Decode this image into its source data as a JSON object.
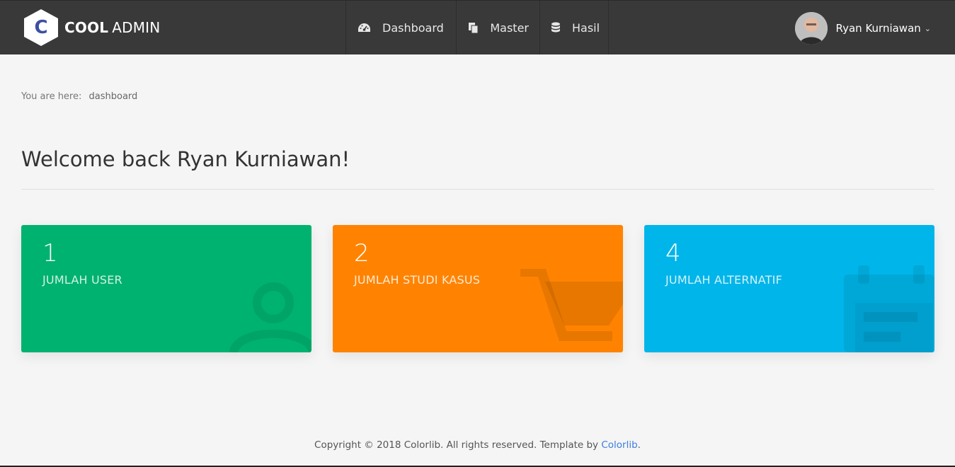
{
  "header": {
    "logo_letter": "C",
    "logo_bold": "COOL",
    "logo_light": "ADMIN",
    "nav": [
      {
        "label": "Dashboard",
        "icon": "dashboard-gauge-icon"
      },
      {
        "label": "Master",
        "icon": "copy-files-icon"
      },
      {
        "label": "Hasil",
        "icon": "database-icon"
      }
    ],
    "user_name": "Ryan Kurniawan",
    "caret": "⌄"
  },
  "breadcrumb": {
    "prefix": "You are here:",
    "current": "dashboard"
  },
  "welcome": "Welcome back Ryan Kurniawan!",
  "cards": [
    {
      "value": "1",
      "label": "JUMLAH USER",
      "color": "#00b26f",
      "icon": "user-icon"
    },
    {
      "value": "2",
      "label": "JUMLAH STUDI KASUS",
      "color": "#ff8300",
      "icon": "shopping-cart-icon"
    },
    {
      "value": "4",
      "label": "JUMLAH ALTERNATIF",
      "color": "#00b5e9",
      "icon": "calendar-icon"
    }
  ],
  "footer": {
    "text": "Copyright © 2018 Colorlib. All rights reserved. Template by ",
    "link": "Colorlib",
    "end": "."
  }
}
